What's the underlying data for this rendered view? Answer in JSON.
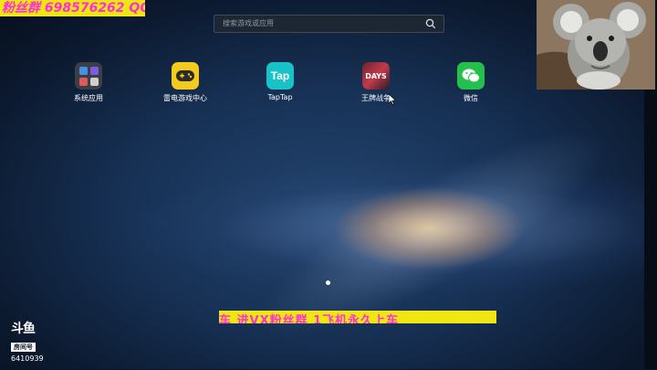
{
  "overlay": {
    "top_banner": "粉丝群  698576262  QQ群",
    "bottom_banner": "车   进VX粉丝群   1飞机永久上车"
  },
  "search": {
    "placeholder": "搜索游戏或应用",
    "icon": "search-icon"
  },
  "apps": [
    {
      "label": "系统应用",
      "icon": "system-apps-icon"
    },
    {
      "label": "雷电游戏中心",
      "icon": "gamepad-icon"
    },
    {
      "label": "TapTap",
      "icon_text": "Tap",
      "icon": "taptap-icon"
    },
    {
      "label": "王牌战争",
      "icon_text": "DAYS",
      "icon": "game-cover-icon"
    },
    {
      "label": "微信",
      "icon": "wechat-icon"
    }
  ],
  "stream": {
    "logo": "斗鱼",
    "room_label": "房间号",
    "room_id": "6410939"
  },
  "colors": {
    "banner_bg": "#f0e614",
    "banner_text": "#ff2fd8",
    "taptap": "#19c2c6",
    "wechat": "#23c14b",
    "leidian": "#f3cb1e"
  }
}
